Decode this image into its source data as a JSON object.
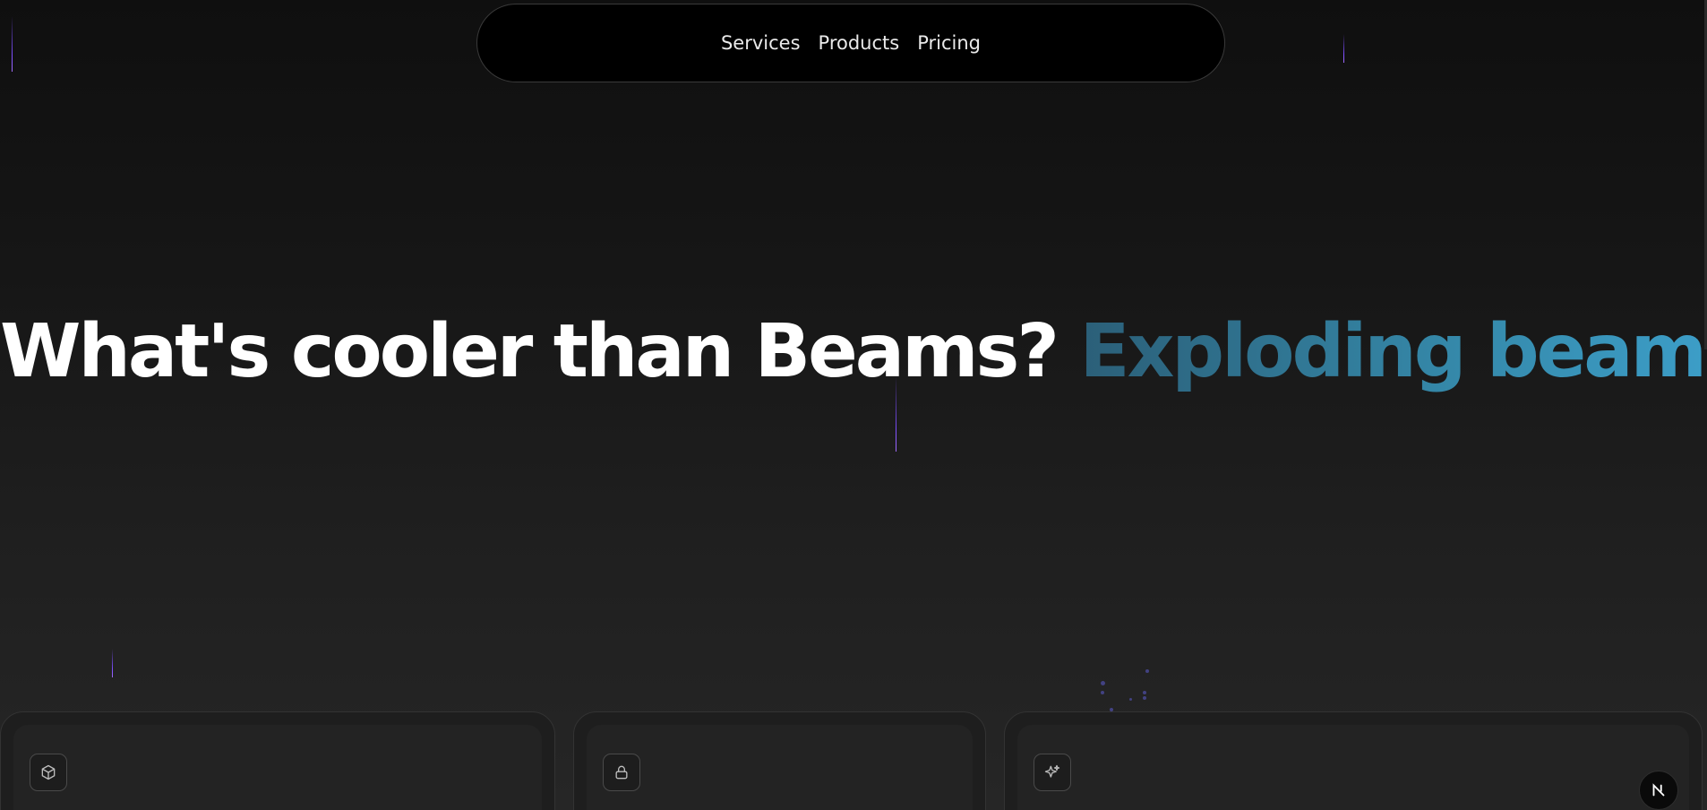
{
  "nav": {
    "links": [
      {
        "label": "Services"
      },
      {
        "label": "Products"
      },
      {
        "label": "Pricing"
      }
    ]
  },
  "hero": {
    "title_main": "What's cooler than Beams?",
    "title_accent": "Exploding beams."
  },
  "cards": [
    {
      "icon": "box-icon"
    },
    {
      "icon": "lock-icon"
    },
    {
      "icon": "sparkles-icon"
    }
  ],
  "colors": {
    "background": "#111111",
    "nav_background": "#000000",
    "accent_gradient_start": "#2b5f78",
    "accent_gradient_end": "#3ea3cf",
    "beam": "#7c4dff"
  },
  "corner_button": {
    "icon": "next-logo-icon"
  }
}
